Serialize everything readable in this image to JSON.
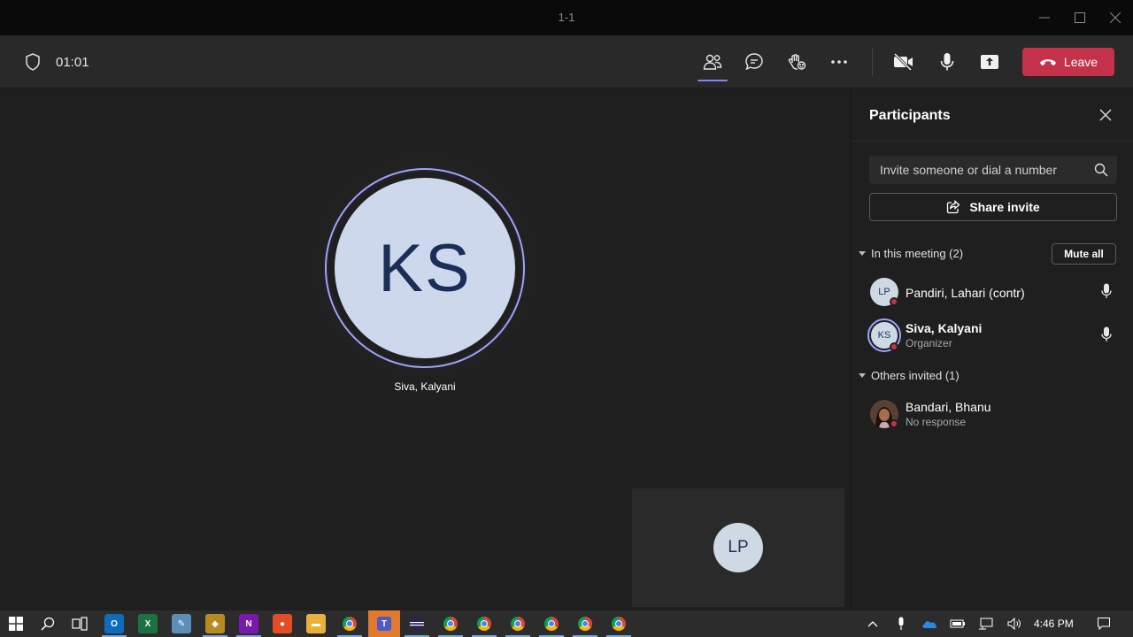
{
  "window": {
    "title": "1-1"
  },
  "toolbar": {
    "timer": "01:01",
    "leave_label": "Leave"
  },
  "stage": {
    "main_initials": "KS",
    "main_name": "Siva, Kalyani",
    "tile_initials": "LP"
  },
  "panel": {
    "title": "Participants",
    "search_placeholder": "Invite someone or dial a number",
    "share_label": "Share invite",
    "in_meeting_label": "In this meeting (2)",
    "mute_all_label": "Mute all",
    "others_label": "Others invited (1)",
    "participants": [
      {
        "initials": "LP",
        "name": "Pandiri, Lahari (contr)",
        "role": ""
      },
      {
        "initials": "KS",
        "name": "Siva, Kalyani",
        "role": "Organizer"
      }
    ],
    "invited": [
      {
        "name": "Bandari, Bhanu",
        "status": "No response"
      }
    ]
  },
  "taskbar": {
    "clock": "4:46 PM",
    "apps": [
      "windows-start",
      "search",
      "task-view",
      "outlook",
      "excel",
      "notepad",
      "git",
      "onenote",
      "paint",
      "file-explorer",
      "chrome",
      "teams",
      "eclipse",
      "chrome",
      "chrome",
      "chrome",
      "chrome",
      "chrome",
      "chrome"
    ]
  },
  "colors": {
    "accent": "#7f85f5",
    "leave": "#c4314b",
    "avatar_bg": "#cdd8ed",
    "avatar_text": "#1a2e57"
  }
}
